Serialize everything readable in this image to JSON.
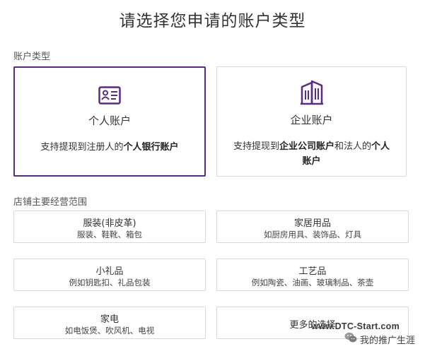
{
  "page_title": "请选择您申请的账户类型",
  "account_section": {
    "label": "账户类型",
    "cards": [
      {
        "name": "个人账户",
        "desc_prefix": "支持提现到注册人的",
        "desc_bold": "个人银行账户",
        "desc_mid": "",
        "desc_bold2": "",
        "icon": "id-card-icon",
        "selected": true
      },
      {
        "name": "企业账户",
        "desc_prefix": "支持提现到",
        "desc_bold": "企业公司账户",
        "desc_mid": "和法人的",
        "desc_bold2": "个人账户",
        "icon": "building-icon",
        "selected": false
      }
    ]
  },
  "category_section": {
    "label": "店铺主要经营范围",
    "items": [
      {
        "title": "服装(非皮革)",
        "subtitle": "服装、鞋靴、箱包"
      },
      {
        "title": "家居用品",
        "subtitle": "如厨房用具、装饰品、灯具"
      },
      {
        "title": "小礼品",
        "subtitle": "例如钥匙扣、礼品包装"
      },
      {
        "title": "工艺品",
        "subtitle": "例如陶瓷、油画、玻璃制品、茶壶"
      },
      {
        "title": "家电",
        "subtitle": "如电饭煲、吹风机、电视"
      },
      {
        "title": "更多的选择",
        "subtitle": ""
      }
    ]
  },
  "watermark": {
    "site": "www.DTC-Start.com",
    "account": "我的推广生涯"
  },
  "colors": {
    "accent": "#5b2b82",
    "border": "#d9d9d9"
  }
}
